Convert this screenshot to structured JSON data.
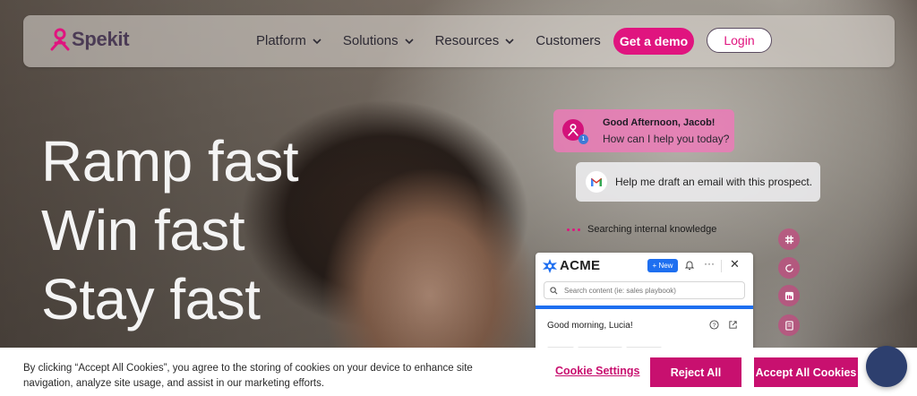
{
  "brand": {
    "name": "Spekit",
    "color": "#e0147f"
  },
  "nav": {
    "items": [
      {
        "label": "Platform",
        "dropdown": true
      },
      {
        "label": "Solutions",
        "dropdown": true
      },
      {
        "label": "Resources",
        "dropdown": true
      },
      {
        "label": "Customers",
        "dropdown": false
      }
    ],
    "demo_label": "Get a demo",
    "login_label": "Login"
  },
  "hero": {
    "lines": [
      "Ramp fast",
      "Win fast",
      "Stay fast"
    ]
  },
  "assistant": {
    "greeting_title": "Good Afternoon, Jacob!",
    "greeting_sub": "How can I help you today?",
    "notification_count": "1",
    "user_prompt": "Help me draft an email with this prospect.",
    "status": "Searching internal knowledge"
  },
  "acme_panel": {
    "name": "ACME",
    "new_label": "+ New",
    "more_label": "···",
    "close_label": "✕",
    "search_placeholder": "Search content (ie: sales playbook)",
    "greeting": "Good morning, Lucia!"
  },
  "cookie_banner": {
    "line1": "By clicking “Accept All Cookies”, you agree to the storing of cookies on your device to enhance site",
    "line2": "navigation, analyze site usage, and assist in our marketing efforts.",
    "settings_label": "Cookie Settings",
    "reject_label": "Reject All",
    "accept_label": "Accept All Cookies"
  },
  "icons": [
    "spekit-logo-icon",
    "chevron-down-icon",
    "gmail-icon",
    "bell-icon",
    "search-icon",
    "help-icon",
    "external-link-icon",
    "chat-icon"
  ]
}
